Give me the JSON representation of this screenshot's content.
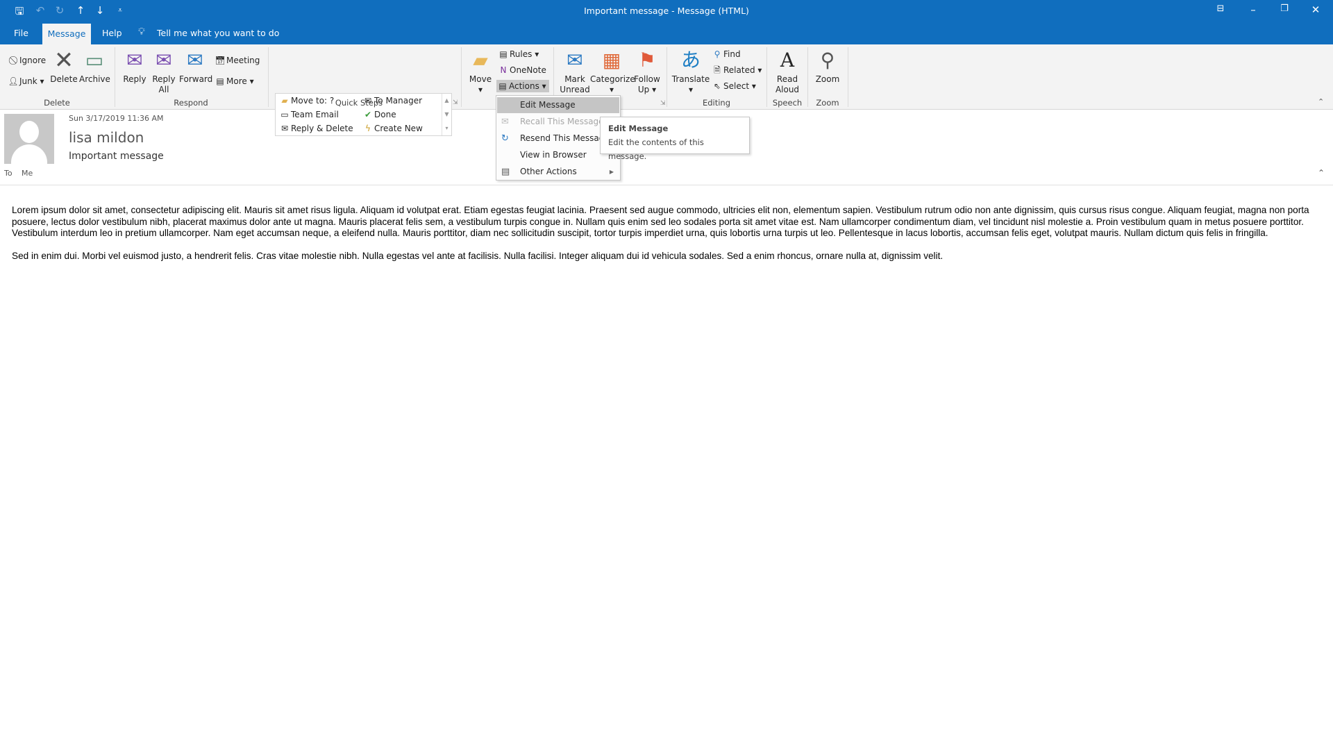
{
  "window": {
    "title": "Important message  -  Message (HTML)",
    "accent": "#106ebe"
  },
  "quick_access": {
    "save": "save-icon",
    "undo": "undo-icon",
    "redo": "redo-icon",
    "up": "up-arrow-icon",
    "down": "down-arrow-icon",
    "customize": "customize-icon"
  },
  "tabs": {
    "file": "File",
    "message": "Message",
    "help": "Help",
    "tell_me": "Tell me what you want to do"
  },
  "ribbon": {
    "delete": {
      "ignore": "Ignore",
      "junk": "Junk",
      "delete": "Delete",
      "archive": "Archive",
      "label": "Delete"
    },
    "respond": {
      "reply": "Reply",
      "reply_all_1": "Reply",
      "reply_all_2": "All",
      "forward": "Forward",
      "meeting": "Meeting",
      "more": "More",
      "label": "Respond"
    },
    "quick_steps": {
      "items": [
        "Move to: ?",
        "Team Email",
        "Reply & Delete",
        "To Manager",
        "Done",
        "Create New"
      ],
      "label": "Quick Steps"
    },
    "move": {
      "move": "Move",
      "rules": "Rules",
      "onenote": "OneNote",
      "actions": "Actions"
    },
    "tags": {
      "mark_1": "Mark",
      "mark_2": "Unread",
      "categorize": "Categorize",
      "follow_1": "Follow",
      "follow_2": "Up"
    },
    "editing": {
      "translate": "Translate",
      "find": "Find",
      "related": "Related",
      "select": "Select",
      "label": "Editing"
    },
    "speech": {
      "read_1": "Read",
      "read_2": "Aloud",
      "label": "Speech"
    },
    "zoom": {
      "zoom": "Zoom",
      "label": "Zoom"
    }
  },
  "actions_menu": {
    "items": [
      "Edit Message",
      "Recall This Message...",
      "Resend This Message...",
      "View in Browser",
      "Other Actions"
    ]
  },
  "tooltip": {
    "title": "Edit Message",
    "text": "Edit the contents of this message."
  },
  "message": {
    "date": "Sun 3/17/2019 11:36 AM",
    "sender": "lisa mildon",
    "subject": "Important message",
    "to_label": "To",
    "to": "Me",
    "body": [
      "Lorem ipsum dolor sit amet, consectetur adipiscing elit. Mauris sit amet risus ligula. Aliquam id volutpat erat. Etiam egestas feugiat lacinia. Praesent sed augue commodo, ultricies elit non, elementum sapien. Vestibulum rutrum odio non ante dignissim, quis cursus risus congue. Aliquam feugiat, magna non porta posuere, lectus dolor vestibulum nibh, placerat maximus dolor ante ut magna. Mauris placerat felis sem, a vestibulum turpis congue in. Nullam quis enim sed leo sodales porta sit amet vitae est. Nam ullamcorper condimentum diam, vel tincidunt nisl molestie a. Proin vestibulum quam in metus posuere porttitor. Vestibulum interdum leo in pretium ullamcorper. Nam eget accumsan neque, a eleifend nulla. Mauris porttitor, diam nec sollicitudin suscipit, tortor turpis imperdiet urna, quis lobortis urna turpis ut leo. Pellentesque in lacus lobortis, accumsan felis eget, volutpat mauris. Nullam dictum quis felis in fringilla.",
      "Sed in enim dui. Morbi vel euismod justo, a hendrerit felis. Cras vitae molestie nibh. Nulla egestas vel ante at facilisis. Nulla facilisi. Integer aliquam dui id vehicula sodales. Sed a enim rhoncus, ornare nulla at, dignissim velit."
    ]
  }
}
